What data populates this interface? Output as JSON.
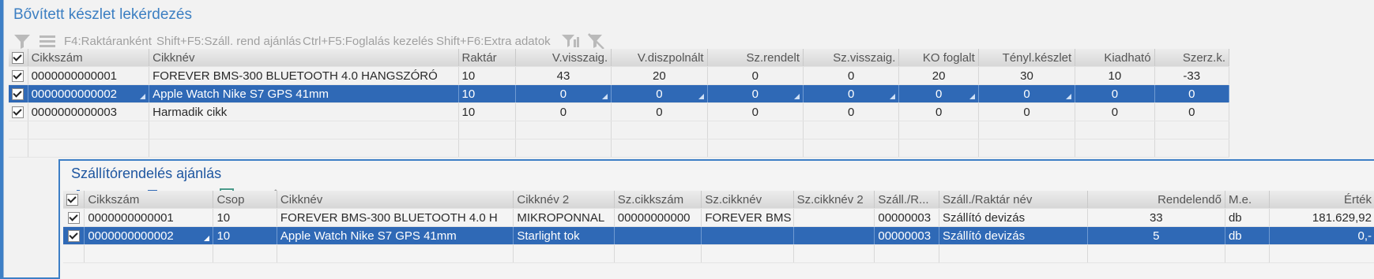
{
  "main": {
    "title": "Bővített készlet lekérdezés",
    "toolbar": {
      "f4": "F4:Raktáranként",
      "shift_f5": "Shift+F5:Száll. rend ajánlás",
      "ctrl_f5": "Ctrl+F5:Foglalás kezelés",
      "shift_f6": "Shift+F6:Extra adatok"
    },
    "columns": [
      "Cikkszám",
      "Cikknév",
      "Raktár",
      "V.visszaig.",
      "V.diszpolnált",
      "Sz.rendelt",
      "Sz.visszaig.",
      "KO foglalt",
      "Tényl.készlet",
      "Kiadható",
      "Szerz.k."
    ],
    "rows": [
      [
        "0000000000001",
        "FOREVER BMS-300 BLUETOOTH 4.0 HANGSZÓRÓ",
        "10",
        "43",
        "20",
        "0",
        "0",
        "20",
        "30",
        "10",
        "-33"
      ],
      [
        "0000000000002",
        "Apple Watch Nike S7 GPS 41mm",
        "10",
        "0",
        "0",
        "0",
        "0",
        "0",
        "0",
        "0",
        "0"
      ],
      [
        "0000000000003",
        "Harmadik cikk",
        "10",
        "0",
        "0",
        "0",
        "0",
        "0",
        "0",
        "0",
        "0"
      ]
    ]
  },
  "dialog": {
    "title": "Szállítórendelés ajánlás",
    "toolbar_icons": [
      "add-icon",
      "edit-icon",
      "list-icon",
      "print-icon",
      "check-list-icon",
      "filter-icon",
      "document-icon",
      "filter-bars-icon",
      "filter-clear-icon"
    ],
    "columns": [
      "Cikkszám",
      "Csop",
      "Cikknév",
      "Cikknév 2",
      "Sz.cikkszám",
      "Sz.cikknév",
      "Sz.cikknév 2",
      "Száll./R...",
      "Száll./Raktár név",
      "Rendelendő",
      "M.e.",
      "Érték"
    ],
    "rows": [
      [
        "0000000000001",
        "10",
        "FOREVER BMS-300 BLUETOOTH 4.0 H",
        "MIKROPONNAL",
        "00000000000",
        "FOREVER BMS",
        "",
        "00000003",
        "Szállító devizás",
        "33",
        "db",
        "181.629,92"
      ],
      [
        "0000000000002",
        "10",
        "Apple Watch Nike S7 GPS 41mm",
        "Starlight tok",
        "",
        "",
        "",
        "00000003",
        "Szállító devizás",
        "5",
        "db",
        "0,-"
      ]
    ]
  },
  "colors": {
    "accent": "#3d7fc6",
    "selected_row": "#2f69b6",
    "title_text": "#3c7fc2"
  }
}
